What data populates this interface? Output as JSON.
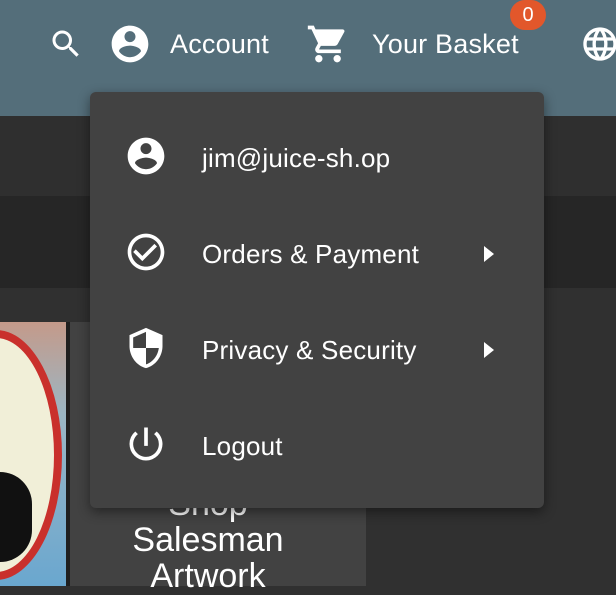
{
  "toolbar": {
    "search_icon": "search-icon",
    "account_label": "Account",
    "basket_label": "Your Basket",
    "basket_count": "0",
    "language_icon": "globe-icon"
  },
  "account_menu": {
    "items": [
      {
        "label": "jim@juice-sh.op",
        "icon": "account-circle-icon",
        "submenu": false
      },
      {
        "label": "Orders & Payment",
        "icon": "check-circle-icon",
        "submenu": true
      },
      {
        "label": "Privacy & Security",
        "icon": "shield-icon",
        "submenu": true
      },
      {
        "label": "Logout",
        "icon": "power-icon",
        "submenu": false
      }
    ]
  },
  "product_card": {
    "title_lines": [
      "Shop",
      "Salesman",
      "Artwork"
    ]
  },
  "colors": {
    "toolbar": "#546e7a",
    "menu_bg": "#424242",
    "badge": "#e2572b",
    "page_bg": "#303030"
  }
}
